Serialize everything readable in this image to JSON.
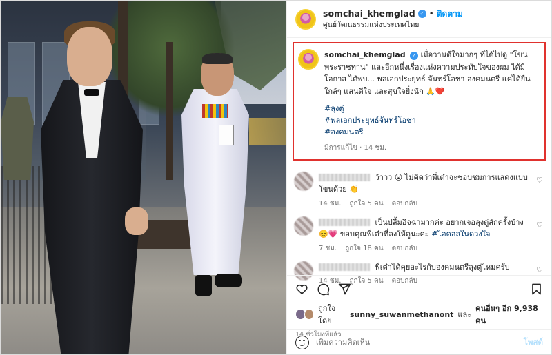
{
  "post": {
    "username": "somchai_khemglad",
    "follow_label": "ติดตาม",
    "separator": "•",
    "location": "ศูนย์วัฒนธรรมแห่งประเทศไทย",
    "caption": {
      "username": "somchai_khemglad",
      "text": "เมื่อวานดีใจมากๆ ที่ได้ไปดู \"โขนพระราชทาน\" และอีกหนึ่งเรื่องแห่งความประทับใจของผม ได้มีโอกาส ได้พบ... พลเอกประยุทธ์ จันทร์โอชา องคมนตรี แค่ได้ยืนใกล้ๆ แสนดีใจ และสุขใจยิ่งนัก 🙏❤️",
      "hashtags": [
        "#ลุงตู่",
        "#พลเอกประยุทธ์จันทร์โอชา",
        "#องคมนตรี"
      ],
      "meta": "มีการแก้ไข · 14 ชม."
    }
  },
  "comments": [
    {
      "text": "ว้าวว 😮 ไม่คิดว่าพี่เต๋าจะชอบชมการแสดงแบบโขนด้วย 👏",
      "time": "14 ชม.",
      "likes": "ถูกใจ 5 คน",
      "reply": "ตอบกลับ"
    },
    {
      "text": "เป็นปลื้มอิจฉามากค่ะ อยากเจอลุงตู่สักครั้งบ้าง ☺️💗 ขอบคุณพี่เต๋าที่ลงให้ดูนะคะ",
      "mention": "#ไอดอลในดวงใจ",
      "time": "7 ชม.",
      "likes": "ถูกใจ 18 คน",
      "reply": "ตอบกลับ"
    },
    {
      "text": "พี่เต๋าได้คุยอะไรกับองคมนตรีลุงตู่ไหมครับ",
      "time": "14 ชม.",
      "likes": "ถูกใจ 5 คน",
      "reply": "ตอบกลับ"
    }
  ],
  "likes_summary": {
    "prefix": "ถูกใจโดย",
    "user": "sunny_suwanmethanont",
    "middle": "และ",
    "others": "คนอื่นๆ อีก 9,938 คน"
  },
  "time_ago": "14 ชั่วโมงที่แล้ว",
  "add_comment": {
    "placeholder": "เพิ่มความคิดเห็น",
    "post_label": "โพสต์"
  },
  "colors": {
    "accent_blue": "#0095f6",
    "highlight_border": "#e0322e",
    "hashtag": "#00376b"
  }
}
